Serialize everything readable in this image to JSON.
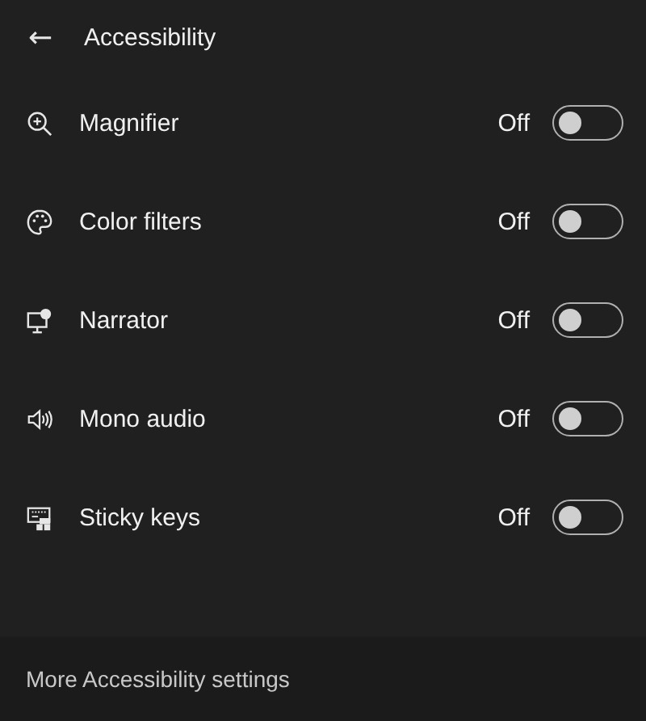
{
  "header": {
    "back": "←",
    "title": "Accessibility"
  },
  "items": [
    {
      "kind": "magnifier",
      "label": "Magnifier",
      "state": "Off",
      "on": false
    },
    {
      "kind": "palette",
      "label": "Color filters",
      "state": "Off",
      "on": false
    },
    {
      "kind": "narrator",
      "label": "Narrator",
      "state": "Off",
      "on": false
    },
    {
      "kind": "speaker",
      "label": "Mono audio",
      "state": "Off",
      "on": false
    },
    {
      "kind": "keyboard",
      "label": "Sticky keys",
      "state": "Off",
      "on": false
    }
  ],
  "footer": {
    "link": "More Accessibility settings"
  }
}
